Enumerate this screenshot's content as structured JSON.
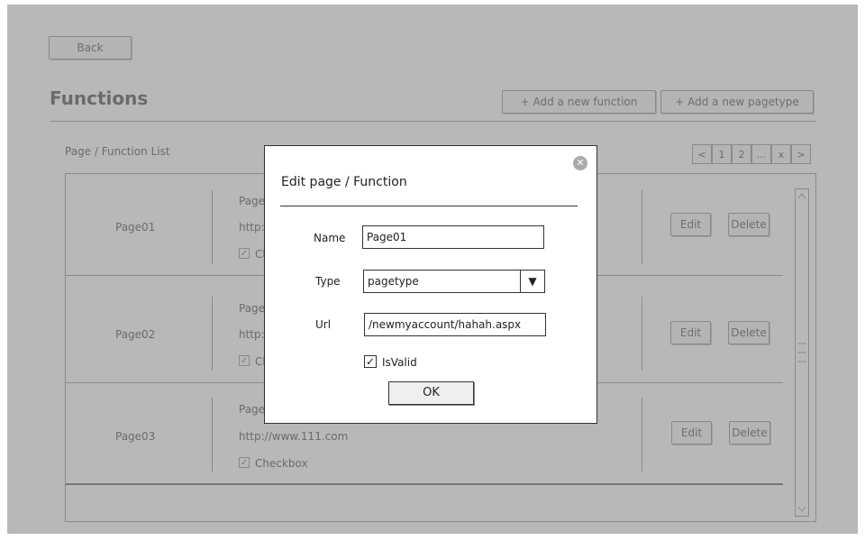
{
  "header": {
    "back_label": "Back",
    "title": "Functions",
    "add_function_label": "+ Add a new function",
    "add_pagetype_label": "+ Add a new pagetype"
  },
  "list": {
    "label": "Page / Function List",
    "pagination": [
      "<",
      "1",
      "2",
      "...",
      "x",
      ">"
    ],
    "rows": [
      {
        "name": "Page01",
        "line1": "Page",
        "line2": "http:",
        "checkbox_label": "Ch",
        "edit": "Edit",
        "delete": "Delete"
      },
      {
        "name": "Page02",
        "line1": "Page",
        "line2": "http:",
        "checkbox_label": "Ch",
        "edit": "Edit",
        "delete": "Delete"
      },
      {
        "name": "Page03",
        "line1": "Page",
        "line2": "http://www.111.com",
        "checkbox_label": "Checkbox",
        "edit": "Edit",
        "delete": "Delete"
      }
    ]
  },
  "modal": {
    "title": "Edit page / Function",
    "name_label": "Name",
    "name_value": "Page01",
    "type_label": "Type",
    "type_value": "pagetype",
    "url_label": "Url",
    "url_value": "/newmyaccount/hahah.aspx",
    "isvalid_label": "IsValid",
    "ok_label": "OK"
  }
}
